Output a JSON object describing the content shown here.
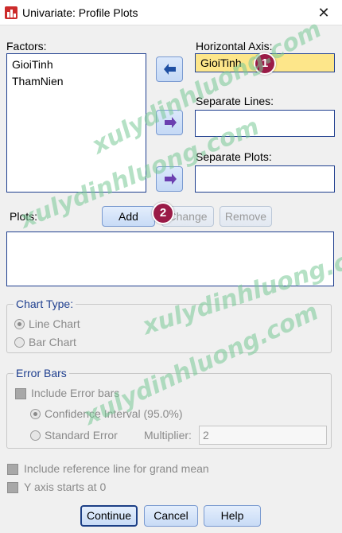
{
  "window": {
    "title": "Univariate: Profile Plots",
    "close_glyph": "✕"
  },
  "factors": {
    "label": "Factors:",
    "items": [
      "GioiTinh",
      "ThamNien"
    ]
  },
  "horizontal_axis": {
    "label": "Horizontal Axis:",
    "value": "GioiTinh"
  },
  "separate_lines": {
    "label": "Separate Lines:",
    "value": ""
  },
  "separate_plots": {
    "label": "Separate Plots:",
    "value": ""
  },
  "plots": {
    "label": "Plots:",
    "add": "Add",
    "change": "Change",
    "remove": "Remove"
  },
  "chart_type": {
    "title": "Chart Type:",
    "line_chart": "Line Chart",
    "bar_chart": "Bar Chart",
    "selected": "Line Chart"
  },
  "error_bars": {
    "title": "Error Bars",
    "include": "Include Error bars",
    "confidence": "Confidence Interval (95.0%)",
    "standard_error": "Standard Error",
    "multiplier_label": "Multiplier:",
    "multiplier_value": "2"
  },
  "options": {
    "grand_mean": "Include reference line for grand mean",
    "y_axis_zero": "Y axis starts at 0"
  },
  "footer": {
    "continue": "Continue",
    "cancel": "Cancel",
    "help": "Help"
  },
  "annotations": {
    "badge1": "1",
    "badge2": "2"
  },
  "watermark": "xulydinhluong.com",
  "colors": {
    "highlight": "#fde68a",
    "badge": "#9a1b47",
    "accent": "#1f3f8f"
  }
}
